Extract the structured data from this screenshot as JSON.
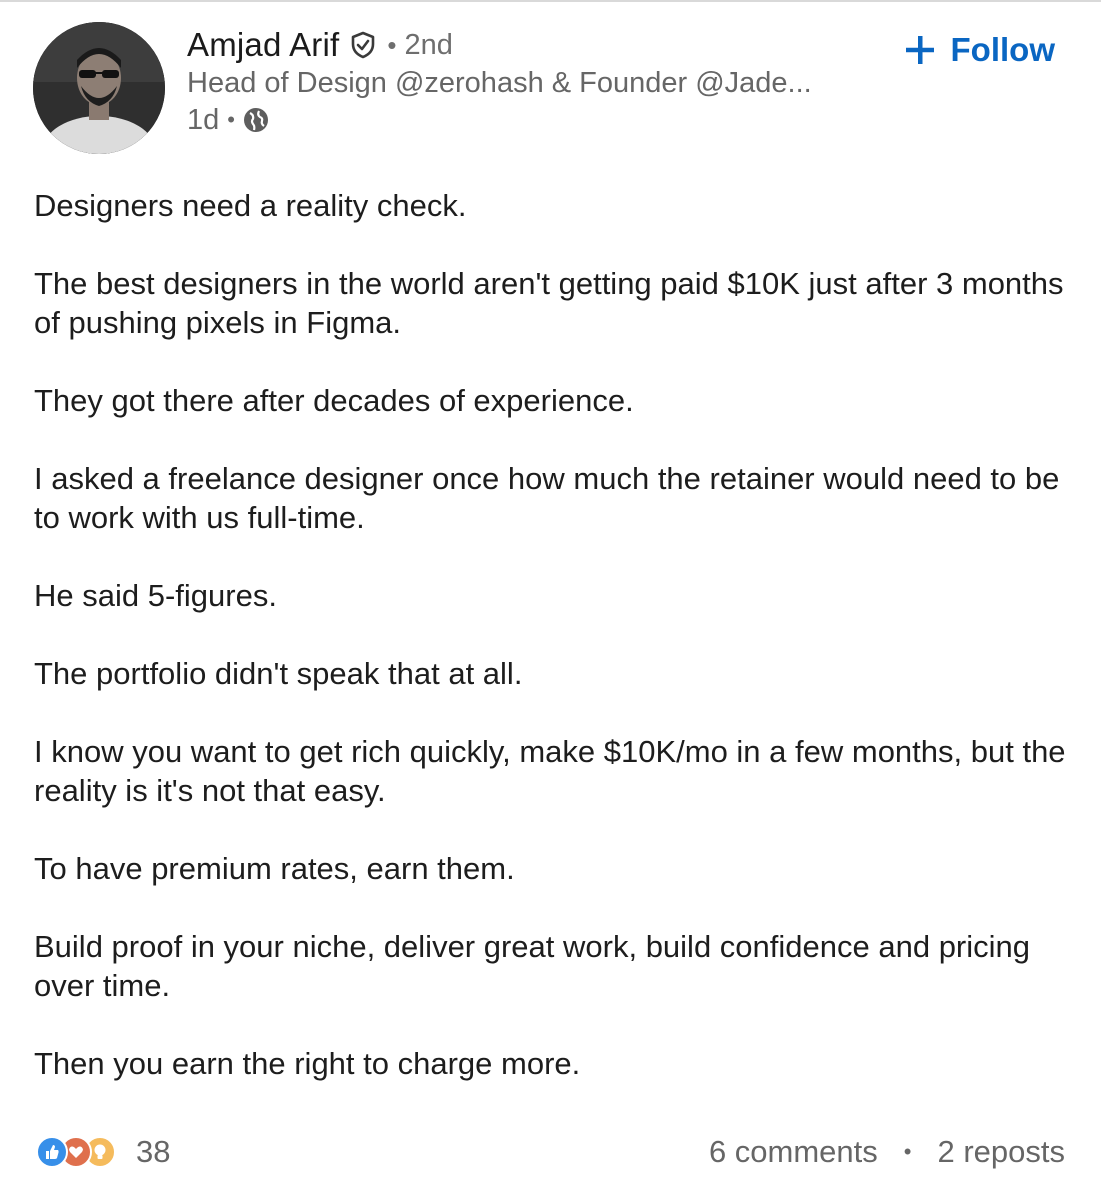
{
  "author": {
    "name": "Amjad Arif",
    "degree": "2nd",
    "headline": "Head of Design @zerohash & Founder @Jade...",
    "time": "1d",
    "verified_icon": "verified-shield-icon",
    "visibility_icon": "globe-icon"
  },
  "follow": {
    "label": "Follow",
    "icon": "plus-icon",
    "color": "#0a66c2"
  },
  "post": {
    "paragraphs": [
      "Designers need a reality check.",
      "The best designers in the world aren't getting paid $10K just after 3 months of pushing pixels in Figma.",
      "They got there after decades of experience.",
      "I asked a freelance designer once how much the retainer would need to be to work with us full-time.",
      "He said 5-figures.",
      "The portfolio didn't speak that at all.",
      "I know you want to get rich quickly, make $10K/mo in a few months, but the reality is it's not that easy.",
      "To have premium rates, earn them.",
      "Build proof in your niche, deliver great work, build confidence and pricing over time.",
      "Then you earn the right to charge more."
    ]
  },
  "footer": {
    "reaction_count": "38",
    "reaction_icons": [
      "like-icon",
      "love-icon",
      "insightful-icon"
    ],
    "comments": "6 comments",
    "reposts": "2 reposts"
  }
}
